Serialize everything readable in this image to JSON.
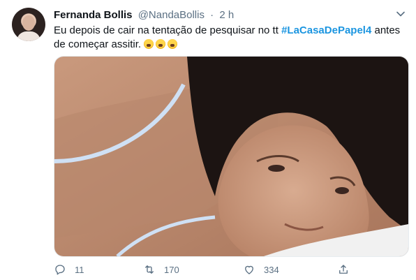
{
  "tweet": {
    "author_name": "Fernanda Bollis",
    "handle": "@NandaBollis",
    "separator": "·",
    "time": "2 h",
    "text_part1": "Eu depois de cair na tentação de pesquisar no tt ",
    "hashtag": "#LaCasaDePapel4",
    "text_part2": " antes de começar assitir.",
    "emoji_count": 3,
    "emoji_name": "loudly-crying-face",
    "media_alt": "photo of a woman lying in bed"
  },
  "actions": {
    "reply_count": "11",
    "retweet_count": "170",
    "like_count": "334"
  },
  "colors": {
    "link": "#1b95e0",
    "meta": "#5b7083",
    "text": "#0f1419"
  },
  "icons": [
    "caret-down-icon",
    "reply-icon",
    "retweet-icon",
    "like-icon",
    "share-icon"
  ]
}
